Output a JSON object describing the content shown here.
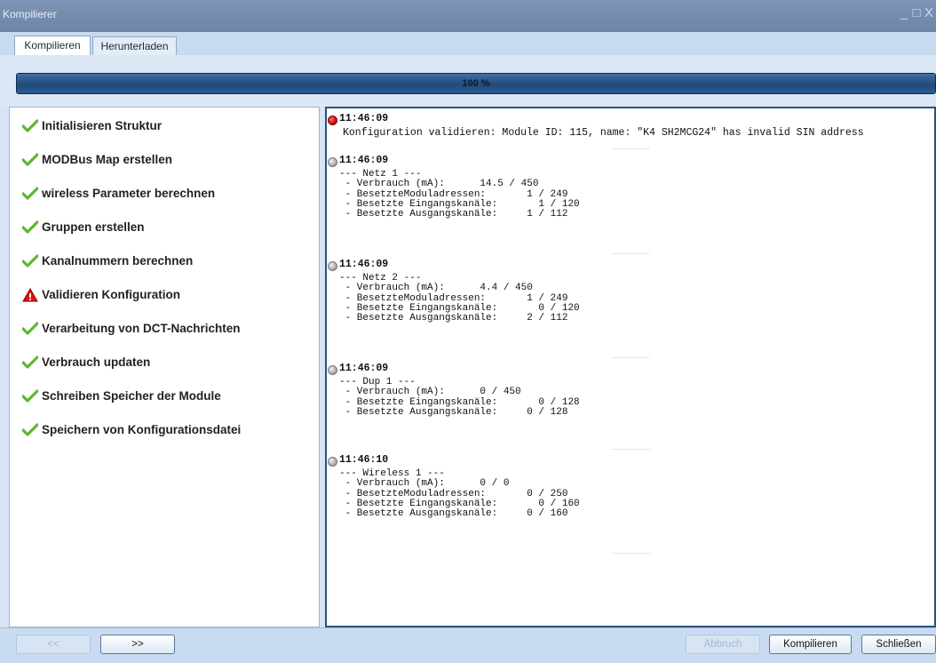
{
  "window": {
    "title": "Kompilierer",
    "controls": [
      "_",
      "□",
      "X"
    ]
  },
  "tabs": [
    {
      "label": "Kompilieren",
      "active": true
    },
    {
      "label": "Herunterladen",
      "active": false
    }
  ],
  "progress": {
    "label": "100 %",
    "value": 1.0
  },
  "steps": [
    {
      "label": "Initialisieren Struktur",
      "status": "ok"
    },
    {
      "label": "MODBus Map erstellen",
      "status": "ok"
    },
    {
      "label": "wireless Parameter berechnen",
      "status": "ok"
    },
    {
      "label": "Gruppen erstellen",
      "status": "ok"
    },
    {
      "label": "Kanalnummern berechnen",
      "status": "ok"
    },
    {
      "label": "Validieren Konfiguration",
      "status": "warning"
    },
    {
      "label": "Verarbeitung von DCT-Nachrichten",
      "status": "ok"
    },
    {
      "label": "Verbrauch updaten",
      "status": "ok"
    },
    {
      "label": "Schreiben Speicher der Module",
      "status": "ok"
    },
    {
      "label": "Speichern von Konfigurationsdatei",
      "status": "ok"
    }
  ],
  "log": [
    {
      "time": "11:46:09",
      "level": "error",
      "text": "Konfiguration validieren: Module ID: 115, name: \"K4 SH2MCG24\" has invalid SIN address"
    },
    {
      "time": "11:46:09",
      "level": "info",
      "text": "--- Netz 1 ---\n - Verbrauch (mA):      14.5 / 450\n - BesetzteModuladressen:       1 / 249\n - Besetzte Eingangskanäle:       1 / 120\n - Besetzte Ausgangskanäle:     1 / 112"
    },
    {
      "time": "11:46:09",
      "level": "info",
      "text": "--- Netz 2 ---\n - Verbrauch (mA):      4.4 / 450\n - BesetzteModuladressen:       1 / 249\n - Besetzte Eingangskanäle:       0 / 120\n - Besetzte Ausgangskanäle:     2 / 112"
    },
    {
      "time": "11:46:09",
      "level": "info",
      "text": "--- Dup 1 ---\n - Verbrauch (mA):      0 / 450\n - Besetzte Eingangskanäle:       0 / 128\n - Besetzte Ausgangskanäle:     0 / 128"
    },
    {
      "time": "11:46:10",
      "level": "info",
      "text": "--- Wireless 1 ---\n - Verbrauch (mA):      0 / 0\n - BesetzteModuladressen:       0 / 250\n - Besetzte Eingangskanäle:       0 / 160\n - Besetzte Ausgangskanäle:     0 / 160"
    }
  ],
  "buttons": {
    "prev": {
      "label": "<<",
      "enabled": false
    },
    "next": {
      "label": ">>",
      "enabled": true
    },
    "abort": {
      "label": "Abbruch",
      "enabled": false
    },
    "compile": {
      "label": "Kompilieren",
      "enabled": true
    },
    "close": {
      "label": "Schließen",
      "enabled": true
    }
  },
  "colors": {
    "ok": "#5cb82c",
    "warning": "#e01010",
    "accent": "#2b5180"
  },
  "icons": {
    "ok": "checkmark-icon",
    "warning": "warning-triangle-icon",
    "log_error": "red-dot-icon",
    "log_info": "gray-dot-icon"
  }
}
